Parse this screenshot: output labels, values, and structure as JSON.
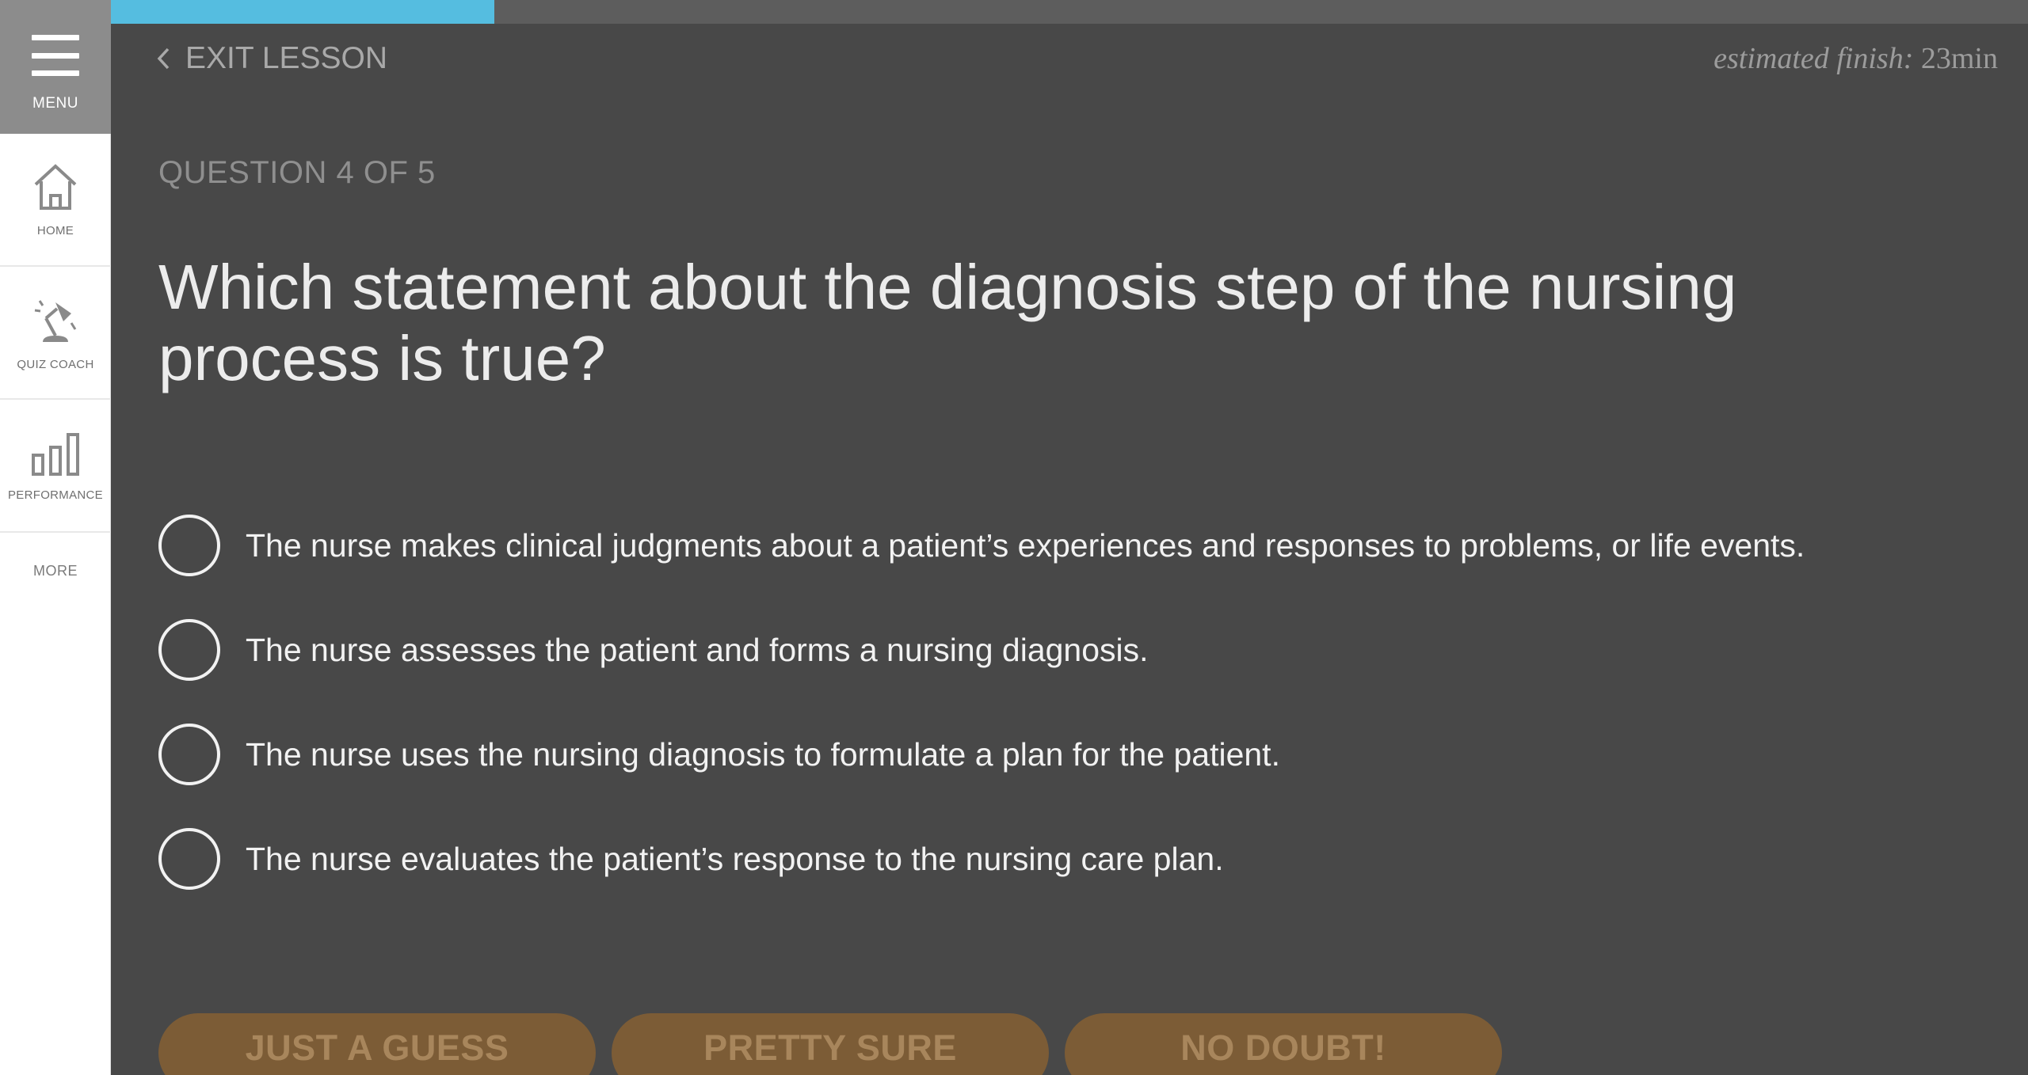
{
  "sidebar": {
    "menu_label": "MENU",
    "items": [
      {
        "label": "HOME",
        "icon": "home-icon"
      },
      {
        "label": "QUIZ COACH",
        "icon": "desk-lamp-icon"
      },
      {
        "label": "PERFORMANCE",
        "icon": "bar-chart-icon"
      }
    ],
    "more_label": "MORE"
  },
  "progress": {
    "fraction": 0.2,
    "color": "#55bde0"
  },
  "header": {
    "exit_label": "EXIT LESSON",
    "estimate_prefix": "estimated finish:",
    "estimate_value": " 23min"
  },
  "question": {
    "counter": "QUESTION 4 OF 5",
    "text": "Which statement about the diagnosis step of the nursing process is true?",
    "choices": [
      "The nurse makes clinical judgments about a patient’s experiences and responses to problems, or life events.",
      "The nurse assesses the patient and forms a nursing diagnosis.",
      "The nurse uses the nursing diagnosis to formulate a plan for the patient.",
      "The nurse evaluates the patient’s response to the nursing care plan."
    ]
  },
  "confidence": {
    "buttons": [
      "JUST A GUESS",
      "PRETTY SURE",
      "NO DOUBT!"
    ],
    "color": "#7c5c36"
  }
}
